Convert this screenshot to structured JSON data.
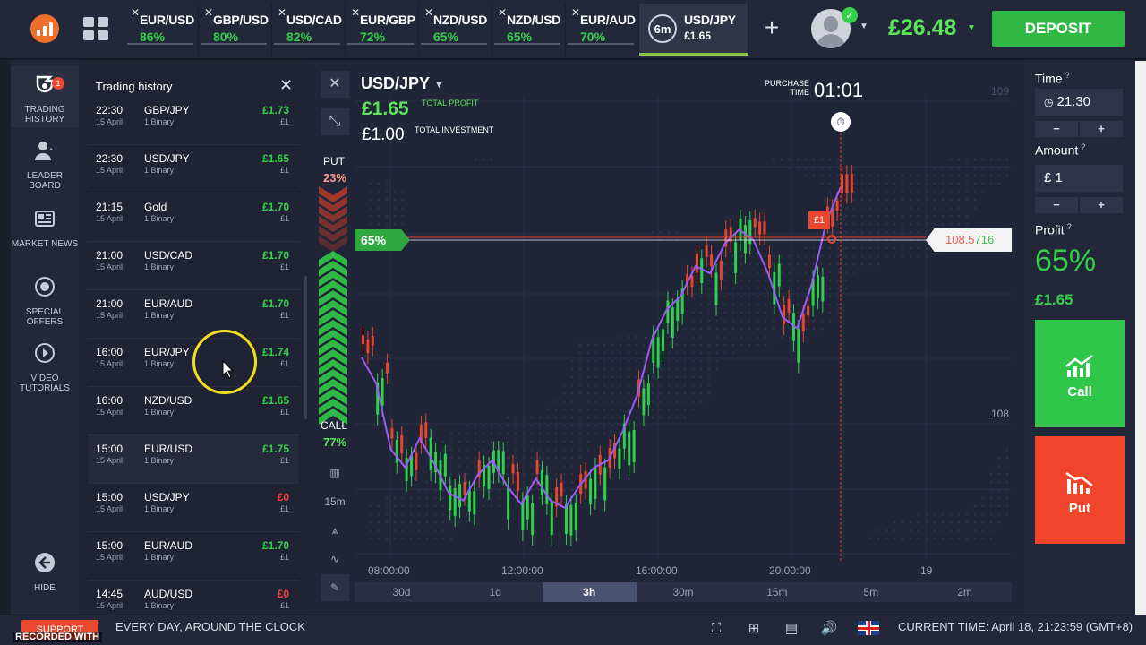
{
  "tabs": [
    {
      "pair": "EUR/USD",
      "pct": "86%"
    },
    {
      "pair": "GBP/USD",
      "pct": "80%"
    },
    {
      "pair": "USD/CAD",
      "pct": "82%"
    },
    {
      "pair": "EUR/GBP",
      "pct": "72%"
    },
    {
      "pair": "NZD/USD",
      "pct": "65%"
    },
    {
      "pair": "NZD/USD",
      "pct": "65%"
    },
    {
      "pair": "EUR/AUD",
      "pct": "70%"
    }
  ],
  "active_tab": {
    "timer": "6m",
    "pair": "USD/JPY",
    "profit": "£1.65"
  },
  "header": {
    "balance": "£26.48",
    "deposit_label": "DEPOSIT"
  },
  "sidebar": {
    "items": [
      {
        "label": "TRADING HISTORY",
        "badge": "1"
      },
      {
        "label": "LEADER BOARD"
      },
      {
        "label": "MARKET NEWS"
      },
      {
        "label": "SPECIAL OFFERS"
      },
      {
        "label": "VIDEO TUTORIALS"
      },
      {
        "label": "HIDE"
      }
    ]
  },
  "history": {
    "title": "Trading history",
    "rows": [
      {
        "time": "22:30",
        "date": "15 April",
        "asset": "GBP/JPY",
        "type": "1 Binary",
        "profit": "£1.73",
        "invest": "£1"
      },
      {
        "time": "22:30",
        "date": "15 April",
        "asset": "USD/JPY",
        "type": "1 Binary",
        "profit": "£1.65",
        "invest": "£1"
      },
      {
        "time": "21:15",
        "date": "15 April",
        "asset": "Gold",
        "type": "1 Binary",
        "profit": "£1.70",
        "invest": "£1"
      },
      {
        "time": "21:00",
        "date": "15 April",
        "asset": "USD/CAD",
        "type": "1 Binary",
        "profit": "£1.70",
        "invest": "£1"
      },
      {
        "time": "21:00",
        "date": "15 April",
        "asset": "EUR/AUD",
        "type": "1 Binary",
        "profit": "£1.70",
        "invest": "£1"
      },
      {
        "time": "16:00",
        "date": "15 April",
        "asset": "EUR/JPY",
        "type": "1 Binary",
        "profit": "£1.74",
        "invest": "£1"
      },
      {
        "time": "16:00",
        "date": "15 April",
        "asset": "NZD/USD",
        "type": "1 Binary",
        "profit": "£1.65",
        "invest": "£1"
      },
      {
        "time": "15:00",
        "date": "15 April",
        "asset": "EUR/USD",
        "type": "1 Binary",
        "profit": "£1.75",
        "invest": "£1"
      },
      {
        "time": "15:00",
        "date": "15 April",
        "asset": "USD/JPY",
        "type": "1 Binary",
        "profit": "£0",
        "invest": "£1"
      },
      {
        "time": "15:00",
        "date": "15 April",
        "asset": "EUR/AUD",
        "type": "1 Binary",
        "profit": "£1.70",
        "invest": "£1"
      },
      {
        "time": "14:45",
        "date": "15 April",
        "asset": "AUD/USD",
        "type": "1 Binary",
        "profit": "£0",
        "invest": "£1"
      }
    ]
  },
  "chart": {
    "pair": "USD/JPY",
    "total_profit": "£1.65",
    "total_profit_label": "TOTAL PROFIT",
    "total_investment": "£1.00",
    "total_investment_label": "TOTAL INVESTMENT",
    "purchase_time_label": "PURCHASE TIME",
    "purchase_time": "01:01",
    "put_label": "PUT",
    "put_pct": "23%",
    "call_label": "CALL",
    "call_pct": "77%",
    "level_pct": "65%",
    "price_low": "108.5",
    "price_high": "716",
    "deal_flag": "£1",
    "y_label_108": "108",
    "y_label_109": "109",
    "x_labels": [
      "08:00:00",
      "12:00:00",
      "16:00:00",
      "20:00:00",
      "19"
    ],
    "timeframes": [
      "30d",
      "1d",
      "3h",
      "30m",
      "15m",
      "5m",
      "2m"
    ],
    "selected_timeframe": "3h",
    "candle_interval": "15m",
    "line_color": "#9b5cf5",
    "up_color": "#2fd04a",
    "down_color": "#e8452e"
  },
  "chart_data": {
    "type": "candlestick",
    "series": [
      {
        "name": "",
        "values": [
          108.25,
          108.18,
          108.0,
          107.95,
          108.03,
          107.96,
          107.88,
          107.86,
          107.93,
          107.97,
          107.9,
          107.85,
          107.92,
          107.86,
          107.84,
          107.9,
          107.95,
          107.97,
          108.05,
          108.15,
          108.3,
          108.38,
          108.42,
          108.5,
          108.48,
          108.56,
          108.6,
          108.57,
          108.48,
          108.36,
          108.33,
          108.45,
          108.62,
          108.716
        ]
      }
    ],
    "ylim": [
      107.7,
      108.85
    ]
  },
  "right_panel": {
    "time_label": "Time",
    "time_value": "21:30",
    "amount_label": "Amount",
    "amount_value": "£ 1",
    "profit_label": "Profit",
    "profit_pct": "65%",
    "profit_amt": "£1.65",
    "call_label": "Call",
    "put_label": "Put",
    "minus": "−",
    "plus": "+"
  },
  "footer": {
    "support": "SUPPORT",
    "recorded": "RECORDED WITH",
    "slogan": "EVERY DAY, AROUND THE CLOCK",
    "current_time": "CURRENT TIME: April 18, 21:23:59 (GMT+8)"
  }
}
